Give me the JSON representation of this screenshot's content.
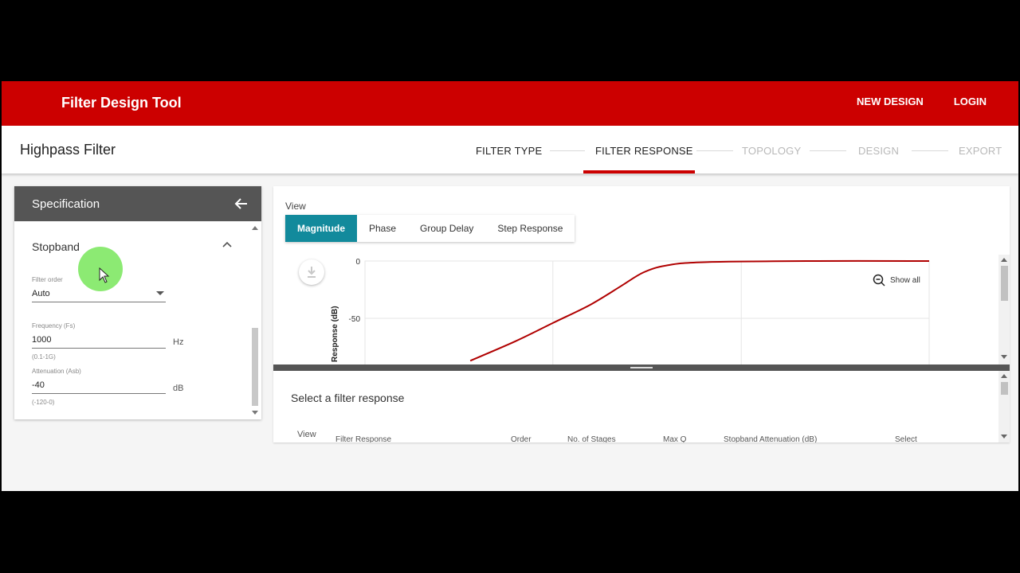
{
  "header": {
    "brand": "Filter Design Tool",
    "nav": [
      "NEW DESIGN",
      "LOGIN"
    ]
  },
  "stepper": {
    "page_title": "Highpass Filter",
    "steps": [
      "FILTER TYPE",
      "FILTER RESPONSE",
      "TOPOLOGY",
      "DESIGN",
      "EXPORT"
    ],
    "active": "FILTER RESPONSE"
  },
  "spec": {
    "title": "Specification",
    "section": "Stopband",
    "filter_order": {
      "label": "Filter order",
      "value": "Auto"
    },
    "frequency": {
      "label": "Frequency (Fs)",
      "value": "1000",
      "unit": "Hz",
      "hint": "(0.1-1G)"
    },
    "attenuation": {
      "label": "Attenuation (Asb)",
      "value": "-40",
      "unit": "dB",
      "hint": "(-120-0)"
    }
  },
  "view": {
    "label": "View",
    "tabs": [
      "Magnitude",
      "Phase",
      "Group Delay",
      "Step Response"
    ],
    "active_tab": "Magnitude",
    "show_all": "Show all"
  },
  "chart_data": {
    "type": "line",
    "ylabel": "Response (dB)",
    "yticks": [
      "0",
      "-50"
    ],
    "series": [
      {
        "color": "#b00000",
        "x": [
          0.48,
          0.6,
          0.7,
          0.8,
          0.88,
          0.94,
          1.0,
          1.1,
          1.4,
          1.7
        ],
        "y": [
          -87,
          -70,
          -54,
          -38,
          -22,
          -10,
          -4,
          -1,
          0,
          0
        ]
      }
    ],
    "line_color": "#b00000"
  },
  "lower": {
    "title": "Select a filter response",
    "view_col": "View",
    "columns": [
      "Filter Response",
      "Order",
      "No. of Stages",
      "Max Q",
      "Stopband Attenuation (dB)",
      "Select"
    ]
  },
  "colors": {
    "brand_red": "#cc0000",
    "active_tab": "#128a9c",
    "panel_header": "#555555"
  }
}
